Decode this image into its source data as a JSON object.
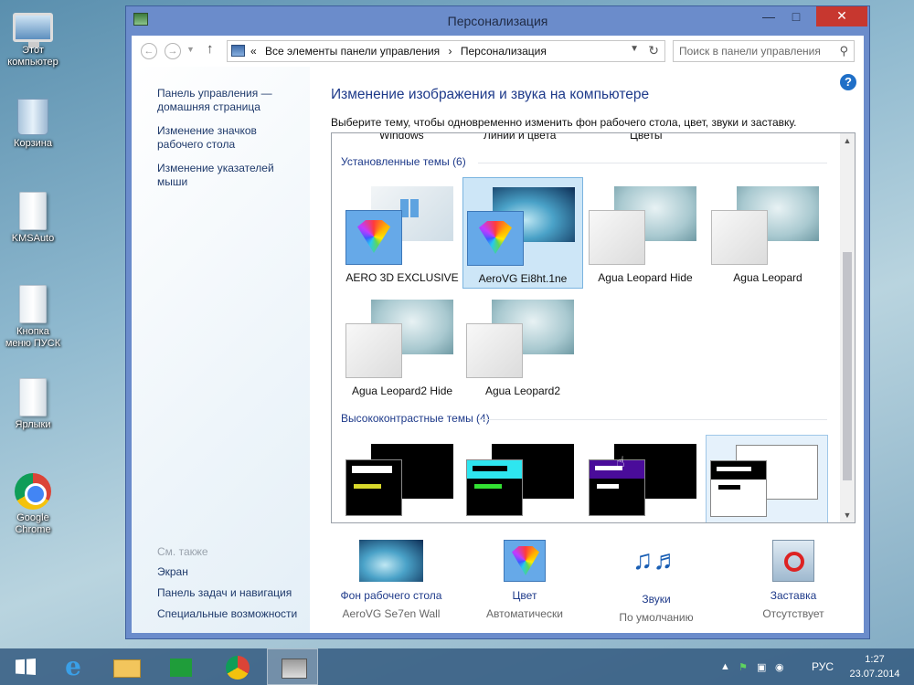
{
  "desktop": {
    "icons": [
      {
        "label": "Этот компьютер"
      },
      {
        "label": "Корзина"
      },
      {
        "label": "KMSAuto"
      },
      {
        "label": "Кнопка меню ПУСК"
      },
      {
        "label": "Ярлыки"
      },
      {
        "label": "Google Chrome"
      }
    ]
  },
  "window": {
    "title": "Персонализация",
    "breadcrumb": [
      "«",
      "Все элементы панели управления",
      "›",
      "Персонализация"
    ],
    "search_placeholder": "Поиск в панели управления"
  },
  "sidebar": {
    "links": [
      "Панель управления — домашняя страница",
      "Изменение значков рабочего стола",
      "Изменение указателей мыши"
    ],
    "see_also_label": "См. также",
    "see_also": [
      "Экран",
      "Панель задач и навигация",
      "Специальные возможности"
    ]
  },
  "main": {
    "heading": "Изменение изображения и звука на компьютере",
    "description": "Выберите тему, чтобы одновременно изменить фон рабочего стола, цвет, звуки и заставку.",
    "cut_labels": [
      "Windows",
      "Линии и цвета",
      "Цветы"
    ],
    "installed_title": "Установленные темы (6)",
    "installed": [
      {
        "name": "AERO 3D EXCLUSIVE",
        "selected": false
      },
      {
        "name": "AeroVG Ei8ht.1ne",
        "selected": true
      },
      {
        "name": "Agua Leopard Hide",
        "selected": false
      },
      {
        "name": "Agua Leopard",
        "selected": false
      },
      {
        "name": "Agua Leopard2 Hide",
        "selected": false
      },
      {
        "name": "Agua Leopard2",
        "selected": false
      }
    ],
    "contrast_title": "Высококонтрастные темы (4)"
  },
  "bottom": [
    {
      "label": "Фон рабочего стола",
      "value": "AeroVG Se7en Wall"
    },
    {
      "label": "Цвет",
      "value": "Автоматически"
    },
    {
      "label": "Звуки",
      "value": "По умолчанию"
    },
    {
      "label": "Заставка",
      "value": "Отсутствует"
    }
  ],
  "taskbar": {
    "language": "РУС",
    "time": "1:27",
    "date": "23.07.2014"
  },
  "colors": {
    "window_frame": "#6b8ccb",
    "link": "#1e3a8a",
    "close_button": "#c7372f"
  }
}
